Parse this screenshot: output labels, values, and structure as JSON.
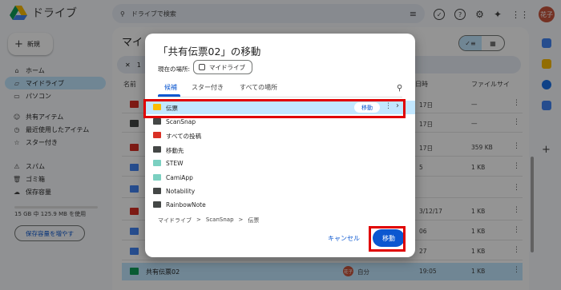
{
  "app": {
    "name": "ドライブ",
    "search_placeholder": "ドライブで検索",
    "avatar_text": "花子"
  },
  "sidebar": {
    "new_label": "新規",
    "items": [
      {
        "label": "ホーム",
        "icon": "home-icon"
      },
      {
        "label": "マイドライブ",
        "icon": "drive-icon",
        "active": true
      },
      {
        "label": "パソコン",
        "icon": "computer-icon"
      },
      {
        "label": "共有アイテム",
        "icon": "people-icon"
      },
      {
        "label": "最近使用したアイテム",
        "icon": "clock-icon"
      },
      {
        "label": "スター付き",
        "icon": "star-icon"
      },
      {
        "label": "スパム",
        "icon": "spam-icon"
      },
      {
        "label": "ゴミ箱",
        "icon": "trash-icon"
      },
      {
        "label": "保存容量",
        "icon": "cloud-icon"
      }
    ],
    "storage_text": "15 GB 中 125.9 MB を使用",
    "storage_fraction": 0.008,
    "storage_button": "保存容量を増やす"
  },
  "main": {
    "title_visible": "マイ",
    "selection_count": "1",
    "columns": {
      "name": "名前",
      "modified": "日時",
      "size": "ファイルサイ"
    },
    "rows": [
      {
        "icon_color": "#d93025",
        "date": "17日",
        "size": "—"
      },
      {
        "icon_color": "#444746",
        "date": "17日",
        "size": "—"
      },
      {
        "icon_color": "#d93025",
        "date": "17日",
        "size": "359 KB"
      },
      {
        "icon_color": "#4285f4",
        "date": "5",
        "size": "1 KB"
      },
      {
        "icon_color": "#4285f4",
        "date": "",
        "size": ""
      },
      {
        "icon_color": "#d93025",
        "date": "3/12/17",
        "size": "1 KB"
      },
      {
        "icon_color": "#4285f4",
        "date": "06",
        "size": "1 KB"
      },
      {
        "icon_color": "#4285f4",
        "date": "27",
        "size": "1 KB"
      }
    ],
    "selected_row": {
      "name": "共有伝票02",
      "owner_avatar": "花子",
      "owner": "自分",
      "date": "19:05",
      "size": "1 KB"
    }
  },
  "dialog": {
    "title": "「共有伝票02」の移動",
    "location_label": "現在の場所:",
    "location_value": "マイドライブ",
    "tabs": [
      "候補",
      "スター付き",
      "すべての場所"
    ],
    "folders": [
      {
        "name": "伝票",
        "color": "#fbbc04",
        "highlight": true
      },
      {
        "name": "ScanSnap",
        "color": "#444746"
      },
      {
        "name": "すべての投稿",
        "color": "#d93025"
      },
      {
        "name": "移動先",
        "color": "#444746"
      },
      {
        "name": "STEW",
        "color": "#7bd0c1"
      },
      {
        "name": "CamiApp",
        "color": "#7bd0c1"
      },
      {
        "name": "Notability",
        "color": "#444746"
      },
      {
        "name": "RainbowNote",
        "color": "#444746"
      }
    ],
    "row_move_label": "移動",
    "breadcrumb": [
      "マイドライブ",
      ">",
      "ScanSnap",
      ">",
      "伝票"
    ],
    "cancel_label": "キャンセル",
    "move_label": "移動"
  },
  "colors": {
    "accent": "#0b57d0",
    "selection": "#c2e7ff",
    "annotation": "#e00000"
  }
}
